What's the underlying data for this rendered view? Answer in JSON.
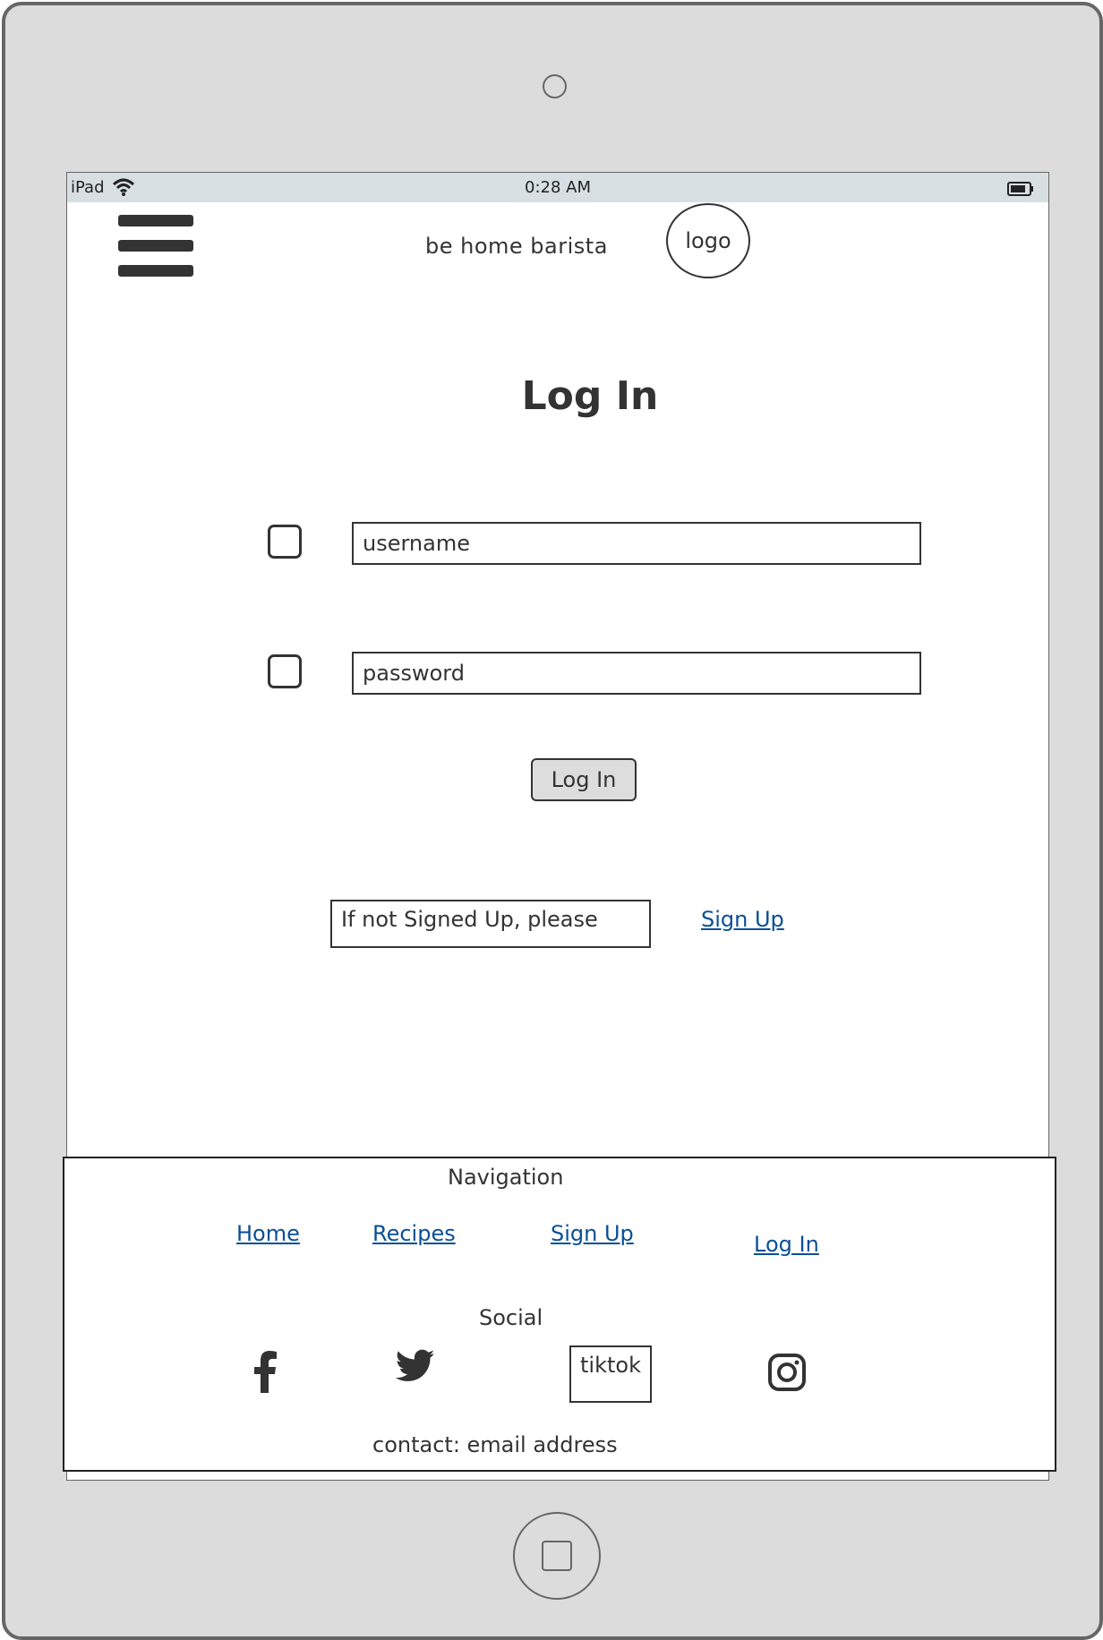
{
  "status_bar": {
    "device": "iPad",
    "time": "0:28 AM"
  },
  "header": {
    "brand_name": "be home barista",
    "logo_label": "logo"
  },
  "main": {
    "title": "Log In",
    "username_placeholder": "username",
    "password_placeholder": "password",
    "login_button_label": "Log In",
    "signup_prompt": "If not Signed Up, please",
    "signup_link": "Sign Up"
  },
  "footer": {
    "nav_heading": "Navigation",
    "nav_links": [
      "Home",
      "Recipes",
      "Sign Up",
      "Log In"
    ],
    "social_heading": "Social",
    "social_icons": [
      "facebook-icon",
      "twitter-icon",
      "tiktok",
      "instagram-icon"
    ],
    "tiktok_label": "tiktok",
    "contact": "contact: email address"
  },
  "colors": {
    "device_frame": "#dcdcdc",
    "status_bar": "#d8dfe3",
    "link": "#0a4f96",
    "text": "#333333"
  }
}
